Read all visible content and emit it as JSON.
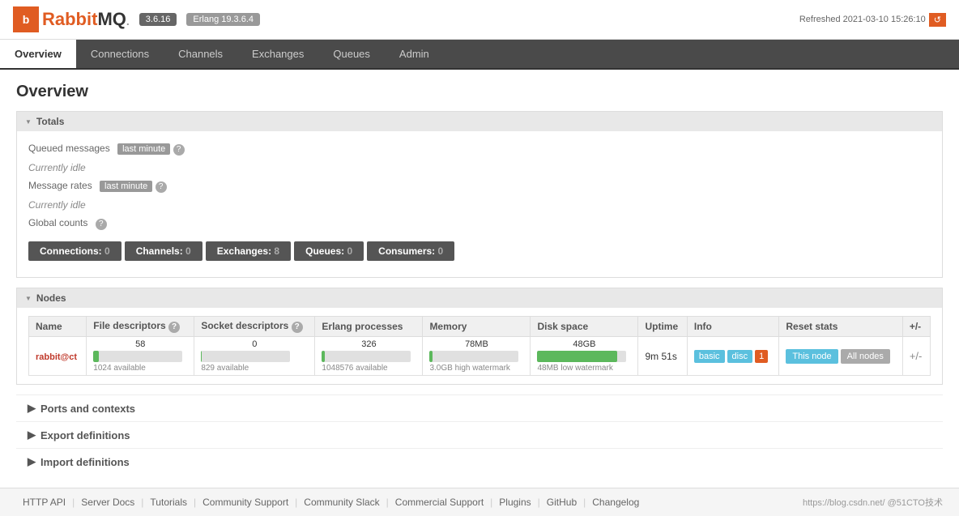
{
  "topbar": {
    "version": "3.6.16",
    "erlang": "Erlang 19.3.6.4",
    "refreshed": "Refreshed 2021-03-10 15:26:10",
    "refresh_btn": "↺"
  },
  "logo": {
    "text": "RabbitMQ",
    "icon": "b"
  },
  "nav": {
    "items": [
      "Overview",
      "Connections",
      "Channels",
      "Exchanges",
      "Queues",
      "Admin"
    ]
  },
  "page": {
    "title": "Overview"
  },
  "totals": {
    "header": "Totals",
    "queued_label": "Queued messages",
    "queued_tag": "last minute",
    "queued_help": "?",
    "idle1": "Currently idle",
    "rates_label": "Message rates",
    "rates_tag": "last minute",
    "rates_help": "?",
    "idle2": "Currently idle",
    "global_label": "Global counts",
    "global_help": "?"
  },
  "counts": [
    {
      "label": "Connections:",
      "value": "0"
    },
    {
      "label": "Channels:",
      "value": "0"
    },
    {
      "label": "Exchanges:",
      "value": "8"
    },
    {
      "label": "Queues:",
      "value": "0"
    },
    {
      "label": "Consumers:",
      "value": "0"
    }
  ],
  "nodes": {
    "header": "Nodes",
    "columns": [
      "Name",
      "File descriptors",
      "Socket descriptors",
      "Erlang processes",
      "Memory",
      "Disk space",
      "Uptime",
      "Info",
      "Reset stats",
      "+/-"
    ],
    "rows": [
      {
        "name": "rabbit@ct",
        "file_desc_val": "58",
        "file_desc_avail": "1024 available",
        "socket_desc_val": "0",
        "socket_desc_avail": "829 available",
        "erlang_val": "326",
        "erlang_avail": "1048576 available",
        "memory_val": "78MB",
        "memory_sub": "3.0GB high watermark",
        "disk_val": "48GB",
        "disk_sub": "48MB low watermark",
        "uptime": "9m 51s",
        "info_basic": "basic",
        "info_disc": "disc",
        "info_num": "1",
        "reset_this": "This node",
        "reset_all": "All nodes"
      }
    ]
  },
  "ports": {
    "header": "Ports and contexts"
  },
  "export": {
    "header": "Export definitions"
  },
  "import": {
    "header": "Import definitions"
  },
  "footer": {
    "links": [
      "HTTP API",
      "Server Docs",
      "Tutorials",
      "Community Support",
      "Community Slack",
      "Commercial Support",
      "Plugins",
      "GitHub",
      "Changelog"
    ],
    "right": "https://blog.csdn.net/ @51CTO技术"
  }
}
